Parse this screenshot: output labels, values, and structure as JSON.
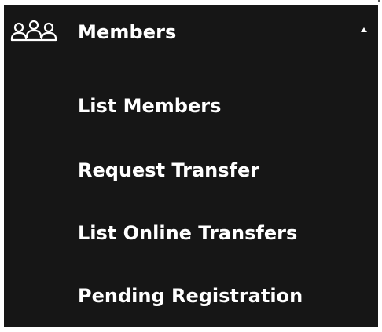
{
  "menu": {
    "header": {
      "label": "Members",
      "icon": "users-group-icon",
      "caret": "caret-up-icon",
      "expanded": true
    },
    "items": [
      {
        "label": "List Members"
      },
      {
        "label": "Request Transfer"
      },
      {
        "label": "List Online Transfers"
      },
      {
        "label": "Pending Registration"
      }
    ],
    "colors": {
      "background": "#161616",
      "text": "#ffffff"
    }
  }
}
